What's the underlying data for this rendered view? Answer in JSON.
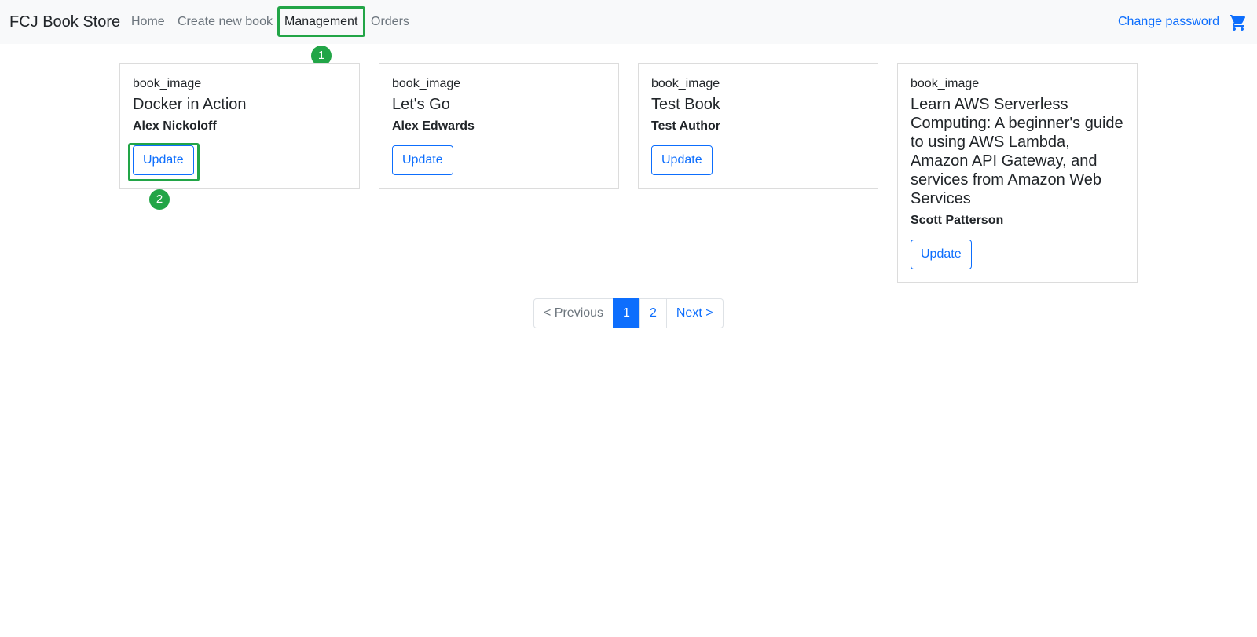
{
  "navbar": {
    "brand": "FCJ Book Store",
    "items": [
      {
        "label": "Home"
      },
      {
        "label": "Create new book"
      },
      {
        "label": "Management"
      },
      {
        "label": "Orders"
      }
    ],
    "change_password": "Change password",
    "cart_icon": "cart-icon"
  },
  "annotations": {
    "badge1": "1",
    "badge2": "2"
  },
  "books": [
    {
      "image_alt": "book_image",
      "title": "Docker in Action",
      "author": "Alex Nickoloff",
      "button": "Update"
    },
    {
      "image_alt": "book_image",
      "title": "Let's Go",
      "author": "Alex Edwards",
      "button": "Update"
    },
    {
      "image_alt": "book_image",
      "title": "Test Book",
      "author": "Test Author",
      "button": "Update"
    },
    {
      "image_alt": "book_image",
      "title": "Learn AWS Serverless Computing: A beginner's guide to using AWS Lambda, Amazon API Gateway, and services from Amazon Web Services",
      "author": "Scott Patterson",
      "button": "Update"
    }
  ],
  "pagination": {
    "previous": "< Previous",
    "pages": [
      "1",
      "2"
    ],
    "current": "1",
    "next": "Next >"
  },
  "colors": {
    "accent": "#0d6efd",
    "highlight": "#22a547",
    "navbar_bg": "#f8f9fa"
  }
}
